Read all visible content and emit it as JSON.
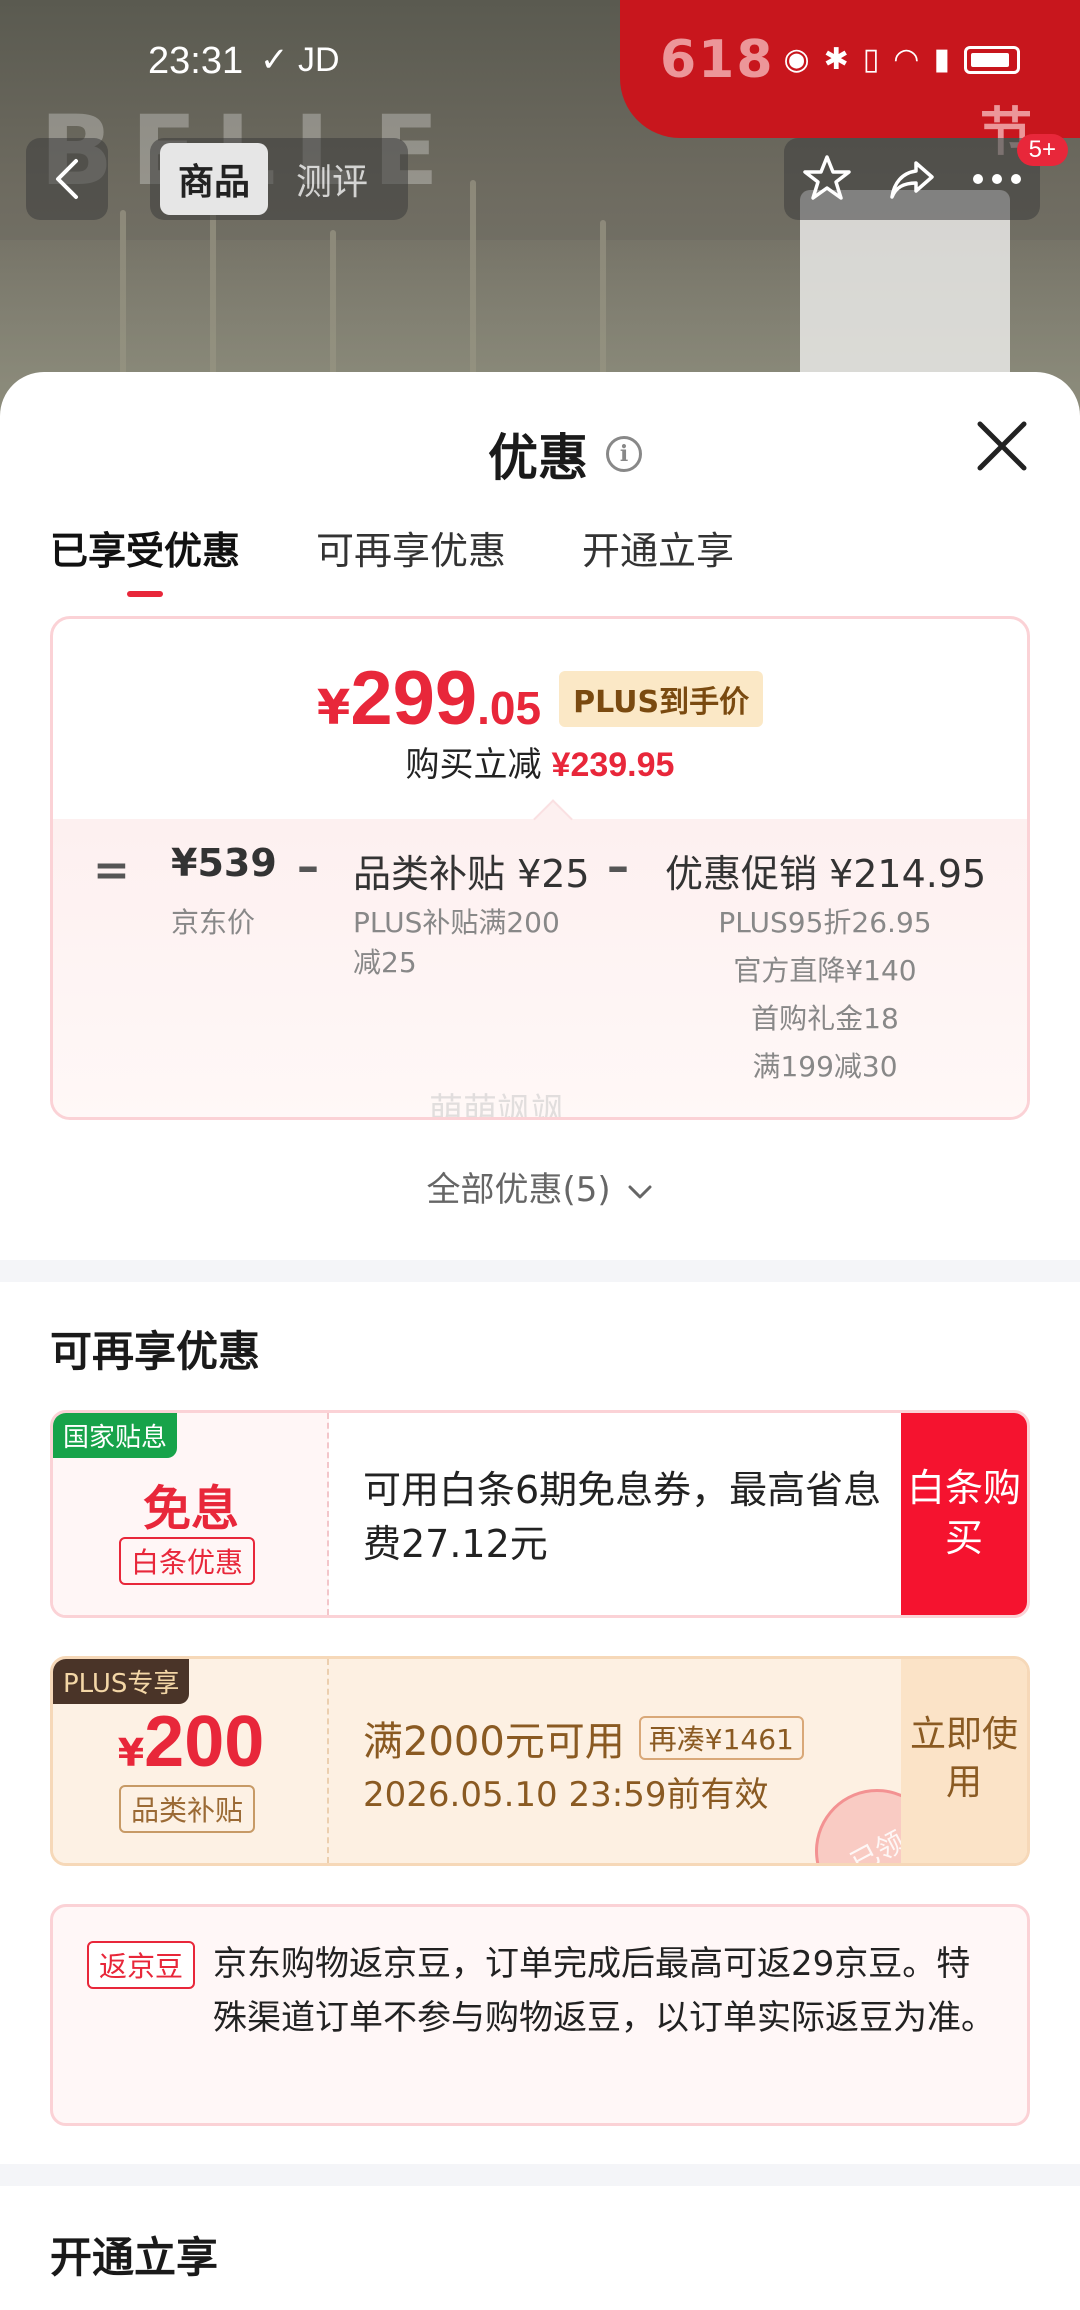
{
  "status_bar": {
    "time": "23:31",
    "carrier": "JD"
  },
  "background": {
    "brand": "BELLE",
    "festival": "618",
    "festival_suffix": "节"
  },
  "product_nav": {
    "tabs": [
      {
        "label": "商品"
      },
      {
        "label": "测评"
      }
    ],
    "badge": "5+"
  },
  "sheet": {
    "title": "优惠",
    "tabs": [
      {
        "label": "已享受优惠"
      },
      {
        "label": "可再享优惠"
      },
      {
        "label": "开通立享"
      }
    ],
    "price_card": {
      "currency": "¥",
      "price_int": "299",
      "price_dec": ".05",
      "plus_label": "PLUS到手价",
      "reduce_label": "购买立减",
      "reduce_value": "¥239.95",
      "equals": "=",
      "minus": "–",
      "jd_price_value": "¥539",
      "jd_price_label": "京东价",
      "subsidy_value": "品类补贴 ¥25",
      "subsidy_details": [
        "PLUS补贴满200",
        "减25"
      ],
      "promo_value": "优惠促销 ¥214.95",
      "promo_details": [
        "PLUS95折26.95",
        "官方直降¥140",
        "首购礼金18",
        "满199减30"
      ],
      "watermark": "萌萌飒飒"
    },
    "all_offers": "全部优惠(5)",
    "section_more": "可再享优惠",
    "coupon_installment": {
      "badge": "国家贴息",
      "title": "免息",
      "tag": "白条优惠",
      "description": "可用白条6期免息券，最高省息费27.12元",
      "action": "白条购买"
    },
    "coupon_plus": {
      "badge": "PLUS专享",
      "currency": "¥",
      "amount": "200",
      "tag": "品类补贴",
      "condition": "满2000元可用",
      "more": "再凑¥1461",
      "validity": "2026.05.10 23:59前有效",
      "action": "立即使用",
      "stamp": "已领"
    },
    "jingdou": {
      "tag": "返京豆",
      "description": "京东购物返京豆，订单完成后最高可返29京豆。特殊渠道订单不参与购物返豆，以订单实际返豆为准。"
    },
    "section_open": "开通立享"
  },
  "colors": {
    "accent_red": "#e8273a",
    "plus_gold": "#8a5a22",
    "gov_green": "#17a34a"
  }
}
